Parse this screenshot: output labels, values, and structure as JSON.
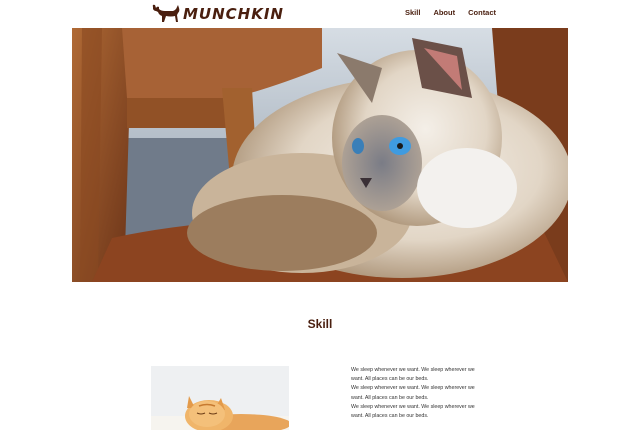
{
  "brand": {
    "name": "MUNCHKIN",
    "icon": "cat-silhouette-icon"
  },
  "nav": {
    "items": [
      {
        "label": "Skill"
      },
      {
        "label": "About"
      },
      {
        "label": "Contact"
      }
    ]
  },
  "hero": {
    "image": "fluffy-ragdoll-cat-on-wooden-chair"
  },
  "skill": {
    "title": "Skill",
    "image": "orange-tabby-cat-sleeping",
    "lines": [
      "We sleep whenever we want. We sleep wherever we",
      "want. All places can be our beds.",
      "We sleep whenever we want. We sleep wherever we",
      "want. All places can be our beds.",
      "We sleep whenever we want. We sleep wherever we",
      "want. All places can be our beds."
    ]
  },
  "colors": {
    "brand_brown": "#4a1f0f",
    "text": "#333333",
    "background": "#ffffff"
  }
}
